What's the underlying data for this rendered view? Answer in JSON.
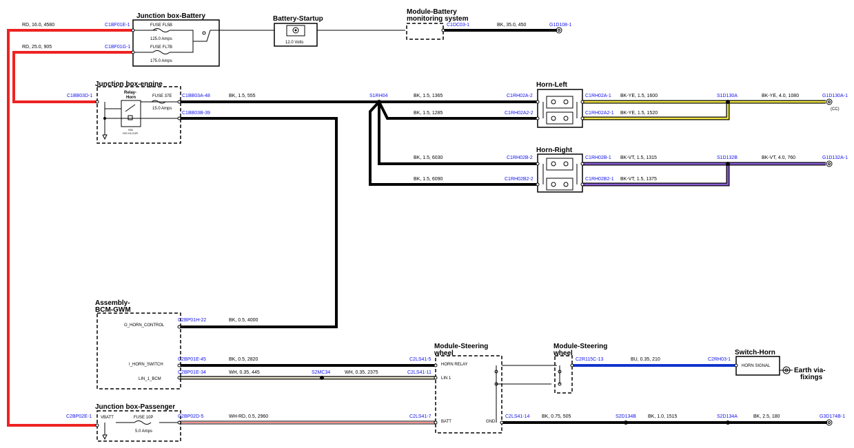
{
  "components": {
    "jb_battery": "Junction box-Battery",
    "battery_startup": "Battery-Startup",
    "bms_line1": "Module-Battery",
    "bms_line2": "monitoring system",
    "jb_engine": "Junction box-engine",
    "relay_line1": "Relay-",
    "relay_line2": "Horn",
    "horn_left": "Horn-Left",
    "horn_right": "Horn-Right",
    "bcm_line1": "Assembly-",
    "bcm_line2": "BCM-GWM",
    "jb_passenger": "Junction box-Passenger",
    "msw1_line1": "Module-Steering",
    "msw1_line2": "wheel",
    "msw2_line1": "Module-Steering",
    "msw2_line2": "wheel",
    "switch_horn": "Switch-Horn",
    "earth_line1": "Earth via-",
    "earth_line2": "fixings"
  },
  "fuses": {
    "fl5b_name": "FUSE FL5B",
    "fl5b_rating": "125.0 Amps",
    "fl7b_name": "FUSE FL7B",
    "fl7b_rating": "175.0 Amps",
    "f37e_name": "FUSE 37E",
    "f37e_rating": "15.0 Amps",
    "f10p_name": "FUSE 10P",
    "f10p_rating": "5.0 Amps",
    "battery_voltage": "12.0 Volts",
    "relay_code1": "936",
    "relay_code2": "ISO HI-CUR"
  },
  "connectors": {
    "c1bf01e": "C1BF01E-1",
    "c1bf01g": "C1BF01G-1",
    "c1dc03": "C1DC03-1",
    "g1d108": "G1D108-1",
    "c1bb03d": "C1BB03D-1",
    "c1bb03a": "C1BB03A-48",
    "c1bb03b": "C1BB03B-39",
    "s1rh04": "S1RH04",
    "c1rh02a2_l": "C1RH02A-2",
    "c1rh02a22_l": "C1RH02A2-2",
    "c1rh02a1_r": "C1RH02A-1",
    "c1rh02a21_r": "C1RH02A2-1",
    "s1d130a": "S1D130A",
    "g1d130a": "G1D130A-1",
    "cc": "(CC)",
    "c1rh02b2_l": "C1RH02B-2",
    "c1rh02b22_l": "C1RH02B2-2",
    "c1rh02b1_r": "C1RH02B-1",
    "c1rh02b21_r": "C1RH02B2-1",
    "s1d132b": "S1D132B",
    "g1d132a": "G1D132A-1",
    "c2bp01h": "C2BP01H-22",
    "c2bp01e45": "C2BP01E-45",
    "c2bp01e34": "C2BP01E-34",
    "s2mc34": "S2MC34",
    "c2ls41_5": "C2LS41-5",
    "c2ls41_11": "C2LS41-11",
    "c2bp02e": "C2BP02E-1",
    "c2bp02d": "C2BP02D-5",
    "c2ls41_7": "C2LS41-7",
    "c2ls41_14": "C2LS41-14",
    "s2d134b": "S2D134B",
    "s2d134a": "S2D134A",
    "g3d174b": "G3D174B-1",
    "c2r115c": "C2R115C-13",
    "c2rh03": "C2RH03-1"
  },
  "pins": {
    "o_horn_control": "O_HORN_CONTROL",
    "i_horn_switch": "I_HORN_SWITCH",
    "lin_1_bcm": "LIN_1_BCM",
    "horn_relay": "HORN RELAY",
    "lin1": "LIN 1",
    "batt": "BATT",
    "gnd": "GND",
    "vbatt": "VBATT",
    "horn_signal": "HORN SIGNAL"
  },
  "wires": {
    "w_rd_16": "RD, 16.0, 4580",
    "w_rd_25": "RD, 25.0, 905",
    "w_bk_35": "BK, 35.0, 450",
    "w_bk_555": "BK, 1.5, 555",
    "w_bk_1365": "BK, 1.5, 1365",
    "w_bk_1285": "BK, 1.5, 1285",
    "w_bkye_1600": "BK-YE, 1.5, 1600",
    "w_bkye_1520": "BK-YE, 1.5, 1520",
    "w_bkye_1080": "BK-YE, 4.0, 1080",
    "w_bk_6030": "BK, 1.5, 6030",
    "w_bk_6090": "BK, 1.5, 6090",
    "w_bkvt_1315": "BK-VT, 1.5, 1315",
    "w_bkvt_1375": "BK-VT, 1.5, 1375",
    "w_bkvt_760": "BK-VT, 4.0, 760",
    "w_bk_4000": "BK, 0.5, 4000",
    "w_bk_2820": "BK, 0.5, 2820",
    "w_wh_445": "WH, 0.35, 445",
    "w_wh_2375": "WH, 0.35, 2375",
    "w_whrd_2960": "WH-RD, 0.5, 2960",
    "w_bk_505": "BK, 0.75, 505",
    "w_bk_1515": "BK, 1.0, 1515",
    "w_bk_180": "BK, 2.5, 180",
    "w_bu_210": "BU, 0.35, 210"
  },
  "colors": {
    "red": "#ee2222",
    "black": "#000000",
    "yellow": "#f2e640",
    "violet": "#8a5cd6",
    "blue": "#1133cc",
    "whiteish": "#e8e2c8",
    "connector_text": "#1111ee"
  }
}
